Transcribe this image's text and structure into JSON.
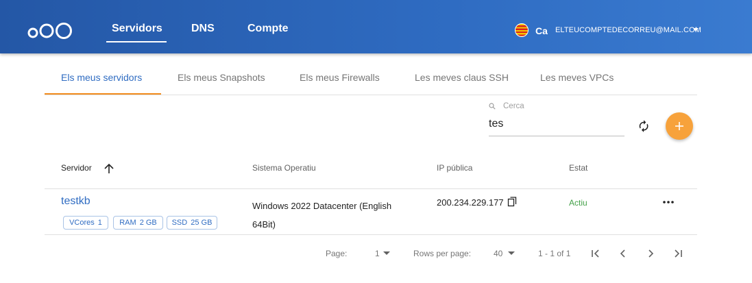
{
  "header": {
    "nav": [
      {
        "label": "Servidors",
        "active": true
      },
      {
        "label": "DNS",
        "active": false
      },
      {
        "label": "Compte",
        "active": false
      }
    ],
    "language": "Ca",
    "email": "ELTEUCOMPTEDECORREU@MAIL.COM",
    "icons": [
      "logo-icon",
      "catalan-flag-icon",
      "chevron-down-icon"
    ]
  },
  "tabs": [
    {
      "label": "Els meus servidors",
      "active": true
    },
    {
      "label": "Els meus Snapshots",
      "active": false
    },
    {
      "label": "Els meus Firewalls",
      "active": false
    },
    {
      "label": "Les meves claus SSH",
      "active": false
    },
    {
      "label": "Les meves VPCs",
      "active": false
    }
  ],
  "search": {
    "label": "Cerca",
    "value": "tes"
  },
  "table": {
    "columns": [
      "Servidor",
      "Sistema Operatiu",
      "IP pública",
      "Estat"
    ],
    "rows": [
      {
        "name": "testkb",
        "specs": [
          {
            "key": "VCores",
            "value": "1"
          },
          {
            "key": "RAM",
            "value": "2 GB"
          },
          {
            "key": "SSD",
            "value": "25 GB"
          }
        ],
        "os": "Windows 2022 Datacenter (English 64Bit)",
        "ip": "200.234.229.177",
        "status": "Actiu"
      }
    ]
  },
  "pagination": {
    "page_label": "Page:",
    "page_value": "1",
    "rows_label": "Rows per page:",
    "rows_value": "40",
    "range": "1 - 1 of 1"
  },
  "colors": {
    "header_bg": "#2f6cc2",
    "accent_orange": "#f28b1c",
    "fab": "#f7a23b",
    "link_blue": "#2f6cc2",
    "status_green": "#43a047"
  }
}
